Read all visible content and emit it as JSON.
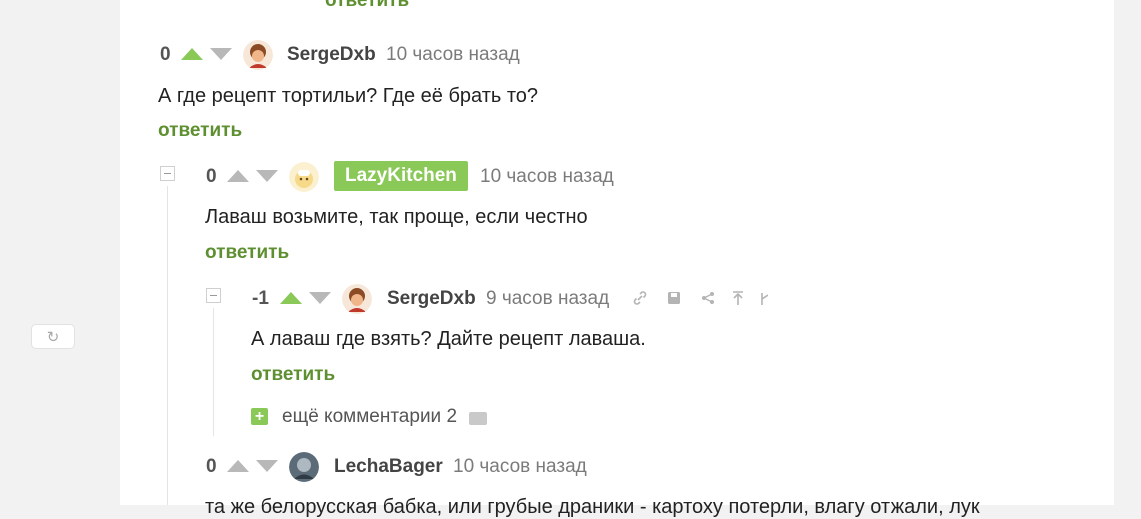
{
  "sidebar": {
    "refresh_icon": "refresh-icon"
  },
  "thread": {
    "top_reply": "ответить",
    "comment1": {
      "rating": "0",
      "author": "SergeDxb",
      "time": "10 часов назад",
      "text": "А где рецепт тортильи? Где её брать то?",
      "reply": "ответить"
    },
    "comment2": {
      "rating": "0",
      "author": "LazyKitchen",
      "time": "10 часов назад",
      "text": "Лаваш возьмите, так проще, если честно",
      "reply": "ответить",
      "author_badge_color": "#8ac858"
    },
    "comment3": {
      "rating": "-1",
      "author": "SergeDxb",
      "time": "9 часов назад",
      "text": "А лаваш где взять? Дайте рецепт лаваша.",
      "reply": "ответить",
      "tools": [
        "link-icon",
        "save-icon",
        "share-icon",
        "arrow-up-icon",
        "more-icon"
      ]
    },
    "more_comments": {
      "label": "ещё комментарии",
      "count": "2"
    },
    "comment4": {
      "rating": "0",
      "author": "LechaBager",
      "time": "10 часов назад",
      "text": "та же белорусская бабка, или грубые драники - картоху потерли, влагу отжали, лук"
    }
  },
  "colors": {
    "accent_green": "#8ac858",
    "link_green": "#5e8f31",
    "upvote_active": "#8ac858"
  }
}
